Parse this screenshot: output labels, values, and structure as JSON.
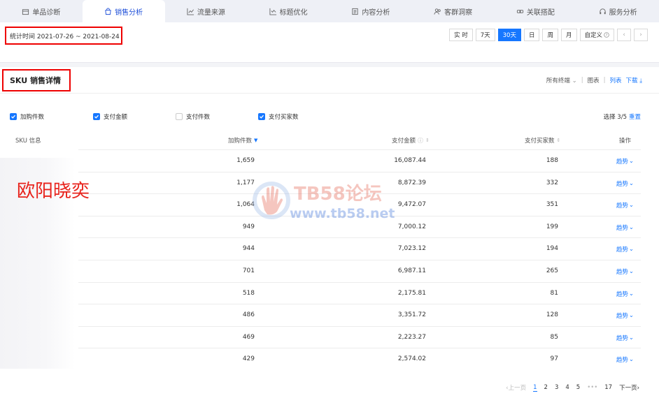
{
  "tabs": [
    {
      "label": "单品诊断",
      "icon": "box-icon",
      "active": false
    },
    {
      "label": "销售分析",
      "icon": "bag-icon",
      "active": true
    },
    {
      "label": "流量来源",
      "icon": "line-chart-icon",
      "active": false
    },
    {
      "label": "标题优化",
      "icon": "trend-chart-icon",
      "active": false
    },
    {
      "label": "内容分析",
      "icon": "document-icon",
      "active": false
    },
    {
      "label": "客群洞察",
      "icon": "users-icon",
      "active": false
    },
    {
      "label": "关联搭配",
      "icon": "link-icon",
      "active": false
    },
    {
      "label": "服务分析",
      "icon": "headset-icon",
      "active": false
    }
  ],
  "date_panel": {
    "range_text": "统计时间 2021-07-26 ~ 2021-08-24",
    "buttons": [
      "实 时",
      "7天",
      "30天",
      "日",
      "周",
      "月",
      "自定义"
    ],
    "active_button": "30天",
    "prev": "‹",
    "next": "›"
  },
  "section": {
    "title": "SKU 销售详情",
    "terminal_select": "所有终端",
    "view_chart": "图表",
    "view_list": "列表",
    "download": "下载"
  },
  "checkboxes": [
    {
      "label": "加购件数",
      "checked": true
    },
    {
      "label": "支付金额",
      "checked": true
    },
    {
      "label": "支付件数",
      "checked": false
    },
    {
      "label": "支付买家数",
      "checked": true
    }
  ],
  "select_info": {
    "text": "选择 3/5",
    "reset": "重置"
  },
  "table": {
    "headers": {
      "sku": "SKU 信息",
      "cart": "加购件数",
      "amount": "支付金额",
      "buyers": "支付买家数",
      "action": "操作"
    },
    "sku_name": "欧阳晓奕",
    "trend_label": "趋势",
    "rows": [
      {
        "cart": "1,659",
        "amount": "16,087.44",
        "buyers": "188"
      },
      {
        "cart": "1,177",
        "amount": "8,872.39",
        "buyers": "332"
      },
      {
        "cart": "1,064",
        "amount": "9,472.07",
        "buyers": "351"
      },
      {
        "cart": "949",
        "amount": "7,000.12",
        "buyers": "199"
      },
      {
        "cart": "944",
        "amount": "7,023.12",
        "buyers": "194"
      },
      {
        "cart": "701",
        "amount": "6,987.11",
        "buyers": "265"
      },
      {
        "cart": "518",
        "amount": "2,175.81",
        "buyers": "81"
      },
      {
        "cart": "486",
        "amount": "3,351.72",
        "buyers": "128"
      },
      {
        "cart": "469",
        "amount": "2,223.27",
        "buyers": "85"
      },
      {
        "cart": "429",
        "amount": "2,574.02",
        "buyers": "97"
      }
    ]
  },
  "watermark": {
    "line1": "TB58论坛",
    "line2": "www.tb58.net"
  },
  "pagination": {
    "prev": "上一页",
    "pages": [
      "1",
      "2",
      "3",
      "4",
      "5"
    ],
    "ellipsis": "•••",
    "last": "17",
    "next": "下一页",
    "current": "1"
  },
  "colors": {
    "accent": "#1677ff",
    "highlight_border": "#ee0000",
    "sku_text": "#e8231c"
  }
}
